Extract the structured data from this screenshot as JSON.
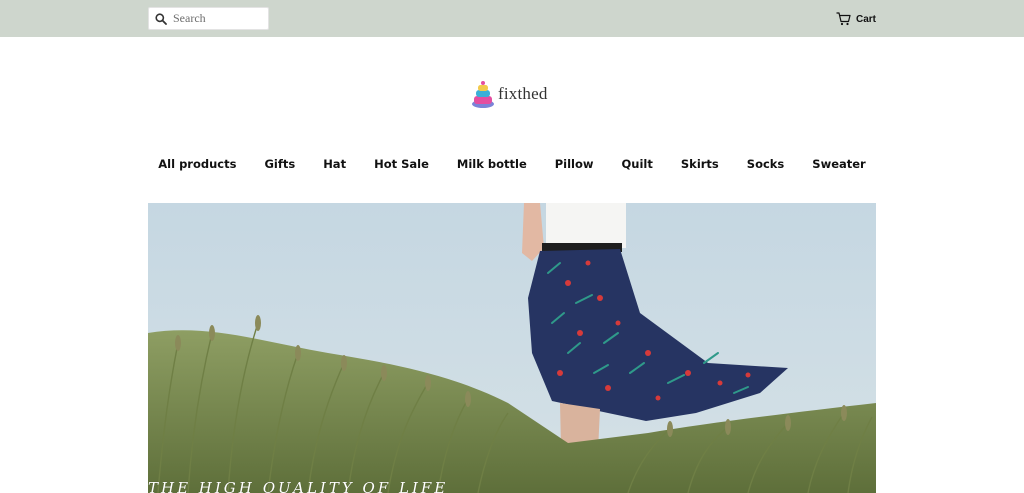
{
  "header": {
    "search": {
      "placeholder": "Search",
      "icon": "search-icon"
    },
    "cart": {
      "label": "Cart",
      "icon": "cart-icon"
    }
  },
  "logo": {
    "text": "fixthed",
    "icon": "cake-logo-icon"
  },
  "nav": {
    "items": [
      "All products",
      "Gifts",
      "Hat",
      "Hot Sale",
      "Milk bottle",
      "Pillow",
      "Quilt",
      "Skirts",
      "Socks",
      "Sweater"
    ]
  },
  "hero": {
    "caption": "THE HIGH QUALITY OF LIFE"
  },
  "colors": {
    "topbar": "#ced6cd",
    "text": "#111111",
    "sky": "#c6d8e3",
    "skirt": "#263462",
    "grass": "#7d8f50"
  }
}
